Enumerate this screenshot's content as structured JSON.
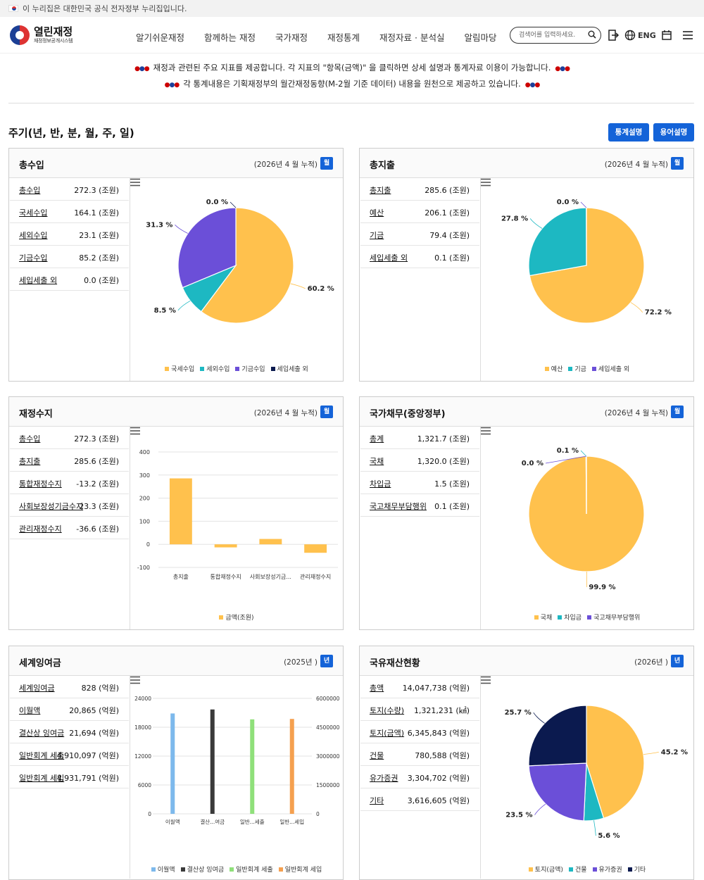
{
  "gov_bar": {
    "text": "이 누리집은 대한민국 공식 전자정부 누리집입니다."
  },
  "header": {
    "logo_title": "열린재정",
    "logo_sub": "재정정보공개시스템",
    "nav": [
      "알기쉬운재정",
      "함께하는 재정",
      "국가재정",
      "재정통계",
      "재정자료 · 분석실",
      "알림마당"
    ],
    "search_placeholder": "검색어를 입력하세요.",
    "lang": "ENG"
  },
  "notice": {
    "line1": "재정과 관련된 주요 지표를 제공합니다. 각 지표의 \"항목(금액)\" 을 클릭하면 상세 설명과 통계자료 이용이 가능합니다.",
    "line2": "각 통계내용은 기획재정부의 월간재정동향(M-2월 기준 데이터) 내용을 원천으로 제공하고 있습니다."
  },
  "page": {
    "title": "주기(년, 반, 분, 월, 주, 일)",
    "btn_stats": "통계설명",
    "btn_terms": "용어설명"
  },
  "colors": {
    "yellow": "#ffc14d",
    "teal": "#1db8c2",
    "purple": "#6b4fd8",
    "navy": "#0b1a4f",
    "blue": "#1463d8"
  },
  "panels": [
    {
      "title": "총수입",
      "period": "(2026년 4 월 누적)",
      "badge": "월",
      "rows": [
        {
          "label": "총수입",
          "value": "272.3 (조원)"
        },
        {
          "label": "국세수입",
          "value": "164.1 (조원)"
        },
        {
          "label": "세외수입",
          "value": "23.1 (조원)"
        },
        {
          "label": "기금수입",
          "value": "85.2 (조원)"
        },
        {
          "label": "세입세출 외",
          "value": "0.0 (조원)"
        }
      ]
    },
    {
      "title": "총지출",
      "period": "(2026년 4 월 누적)",
      "badge": "월",
      "rows": [
        {
          "label": "총지출",
          "value": "285.6 (조원)"
        },
        {
          "label": "예산",
          "value": "206.1 (조원)"
        },
        {
          "label": "기금",
          "value": "79.4 (조원)"
        },
        {
          "label": "세입세출 외",
          "value": "0.1 (조원)"
        }
      ]
    },
    {
      "title": "재정수지",
      "period": "(2026년 4 월 누적)",
      "badge": "월",
      "rows": [
        {
          "label": "총수입",
          "value": "272.3 (조원)"
        },
        {
          "label": "총지출",
          "value": "285.6 (조원)"
        },
        {
          "label": "통합재정수지",
          "value": "-13.2 (조원)"
        },
        {
          "label": "사회보장성기금수지",
          "value": "23.3 (조원)"
        },
        {
          "label": "관리재정수지",
          "value": "-36.6 (조원)"
        }
      ]
    },
    {
      "title": "국가채무(중앙정부)",
      "period": "(2026년 4 월 누적)",
      "badge": "월",
      "rows": [
        {
          "label": "총계",
          "value": "1,321.7 (조원)"
        },
        {
          "label": "국채",
          "value": "1,320.0 (조원)"
        },
        {
          "label": "차입금",
          "value": "1.5 (조원)"
        },
        {
          "label": "국고채무부담행위",
          "value": "0.1 (조원)"
        }
      ]
    },
    {
      "title": "세계잉여금",
      "period": "(2025년 )",
      "badge": "년",
      "rows": [
        {
          "label": "세계잉여금",
          "value": "828 (억원)"
        },
        {
          "label": "이월액",
          "value": "20,865 (억원)"
        },
        {
          "label": "결산상 잉여금",
          "value": "21,694 (억원)"
        },
        {
          "label": "일반회계 세출",
          "value": "4,910,097 (억원)"
        },
        {
          "label": "일반회계 세입",
          "value": "4,931,791 (억원)"
        }
      ]
    },
    {
      "title": "국유재산현황",
      "period": "(2026년 )",
      "badge": "년",
      "rows": [
        {
          "label": "총액",
          "value": "14,047,738 (억원)"
        },
        {
          "label": "토지(수량)",
          "value": "1,321,231 (㎢)"
        },
        {
          "label": "토지(금액)",
          "value": "6,345,843 (억원)"
        },
        {
          "label": "건물",
          "value": "780,588 (억원)"
        },
        {
          "label": "유가증권",
          "value": "3,304,702 (억원)"
        },
        {
          "label": "기타",
          "value": "3,616,605 (억원)"
        }
      ]
    }
  ],
  "chart_data": [
    {
      "type": "pie",
      "categories": [
        "국세수입",
        "세외수입",
        "기금수입",
        "세입세출 외"
      ],
      "values": [
        164.1,
        23.1,
        85.2,
        0.0
      ],
      "labels": [
        "60.2 %",
        "8.5 %",
        "31.3 %",
        "0.0 %"
      ],
      "colors": [
        "#ffc14d",
        "#1db8c2",
        "#6b4fd8",
        "#0b1a4f"
      ],
      "legend": "bottom"
    },
    {
      "type": "pie",
      "categories": [
        "예산",
        "기금",
        "세입세출 외"
      ],
      "values": [
        206.1,
        79.4,
        0.1
      ],
      "labels": [
        "72.2 %",
        "27.8 %",
        "0.0 %"
      ],
      "colors": [
        "#ffc14d",
        "#1db8c2",
        "#6b4fd8"
      ],
      "legend": "bottom"
    },
    {
      "type": "bar",
      "categories": [
        "총지출",
        "통합재정수지",
        "사회보장성기금...",
        "관리재정수지"
      ],
      "series": [
        {
          "name": "금액(조원)",
          "values": [
            285.6,
            -13.2,
            23.3,
            -36.6
          ]
        }
      ],
      "ylim": [
        -100,
        400
      ],
      "yticks": [
        "400",
        "300",
        "200",
        "100",
        "0",
        "-100"
      ],
      "color": "#ffc14d",
      "legend": "bottom"
    },
    {
      "type": "pie",
      "categories": [
        "국채",
        "차입금",
        "국고채무부담행위"
      ],
      "values": [
        1320.0,
        1.5,
        0.1
      ],
      "labels": [
        "99.9 %",
        "0.1 %",
        "0.0 %"
      ],
      "colors": [
        "#ffc14d",
        "#1db8c2",
        "#6b4fd8"
      ],
      "legend": "bottom"
    },
    {
      "type": "bar",
      "categories": [
        "이월액",
        "결산...여금",
        "일반...세출",
        "일반...세입"
      ],
      "series": [
        {
          "name": "이월액",
          "values": [
            20865
          ],
          "axis": "left"
        },
        {
          "name": "결산상 잉여금",
          "values": [
            21694
          ],
          "axis": "left"
        },
        {
          "name": "일반회계 세출",
          "values": [
            4910097
          ],
          "axis": "right"
        },
        {
          "name": "일반회계 세입",
          "values": [
            4931791
          ],
          "axis": "right"
        }
      ],
      "ylim_left": [
        0,
        24000
      ],
      "ylim_right": [
        0,
        6000000
      ],
      "yticks_left": [
        "24000",
        "18000",
        "12000",
        "6000",
        "0"
      ],
      "yticks_right": [
        "6000000",
        "4500000",
        "3000000",
        "1500000",
        "0"
      ],
      "colors": [
        "#7db9ec",
        "#3a3a3a",
        "#8fe07a",
        "#f5a04f"
      ],
      "legend": "bottom"
    },
    {
      "type": "pie",
      "categories": [
        "토지(금액)",
        "건물",
        "유가증권",
        "기타"
      ],
      "values": [
        6345843,
        780588,
        3304702,
        3616605
      ],
      "labels": [
        "45.2 %",
        "5.6 %",
        "23.5 %",
        "25.7 %"
      ],
      "colors": [
        "#ffc14d",
        "#1db8c2",
        "#6b4fd8",
        "#0b1a4f"
      ],
      "legend": "bottom"
    }
  ]
}
